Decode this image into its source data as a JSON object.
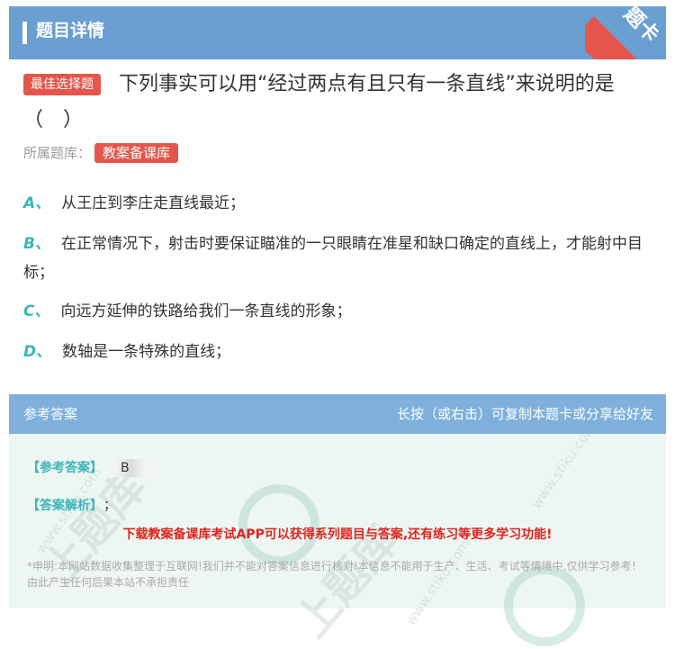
{
  "header": {
    "title": "题目详情"
  },
  "ribbon": {
    "text": "题卡"
  },
  "question": {
    "type_badge": "最佳选择题",
    "text": "下列事实可以用“经过两点有且只有一条直线”来说明的是",
    "paren": "（　）",
    "source_label": "所属题库：",
    "source_badge": "教案备课库"
  },
  "options": [
    {
      "letter": "A、",
      "text": "从王庄到李庄走直线最近；"
    },
    {
      "letter": "B、",
      "text": "在正常情况下，射击时要保证瞄准的一只眼睛在准星和缺口确定的直线上，才能射中目标；"
    },
    {
      "letter": "C、",
      "text": "向远方延伸的铁路给我们一条直线的形象；"
    },
    {
      "letter": "D、",
      "text": "数轴是一条特殊的直线；"
    }
  ],
  "answer": {
    "header_left": "参考答案",
    "header_right": "长按（或右击）可复制本题卡或分享给好友",
    "answer_label": "【参考答案】",
    "answer_value": "B",
    "analysis_label": "【答案解析】",
    "analysis_value": "；",
    "promo": "下载教案备课库考试APP可以获得系列题目与答案,还有练习等更多学习功能!",
    "disclaimer": "*申明:本网站数据收集整理于互联网!我们并不能对答案信息进行核对!本信息不能用于生产、生活、考试等情境中,仅供学习参考！由此产生任何后果本站不承担责任"
  },
  "watermark": {
    "site": "www.stiku.com",
    "brand": "上题库"
  },
  "colors": {
    "header": "#6a9fd1",
    "badge": "#e4564b",
    "accent": "#3cb6b8",
    "promo": "#e0241d"
  }
}
